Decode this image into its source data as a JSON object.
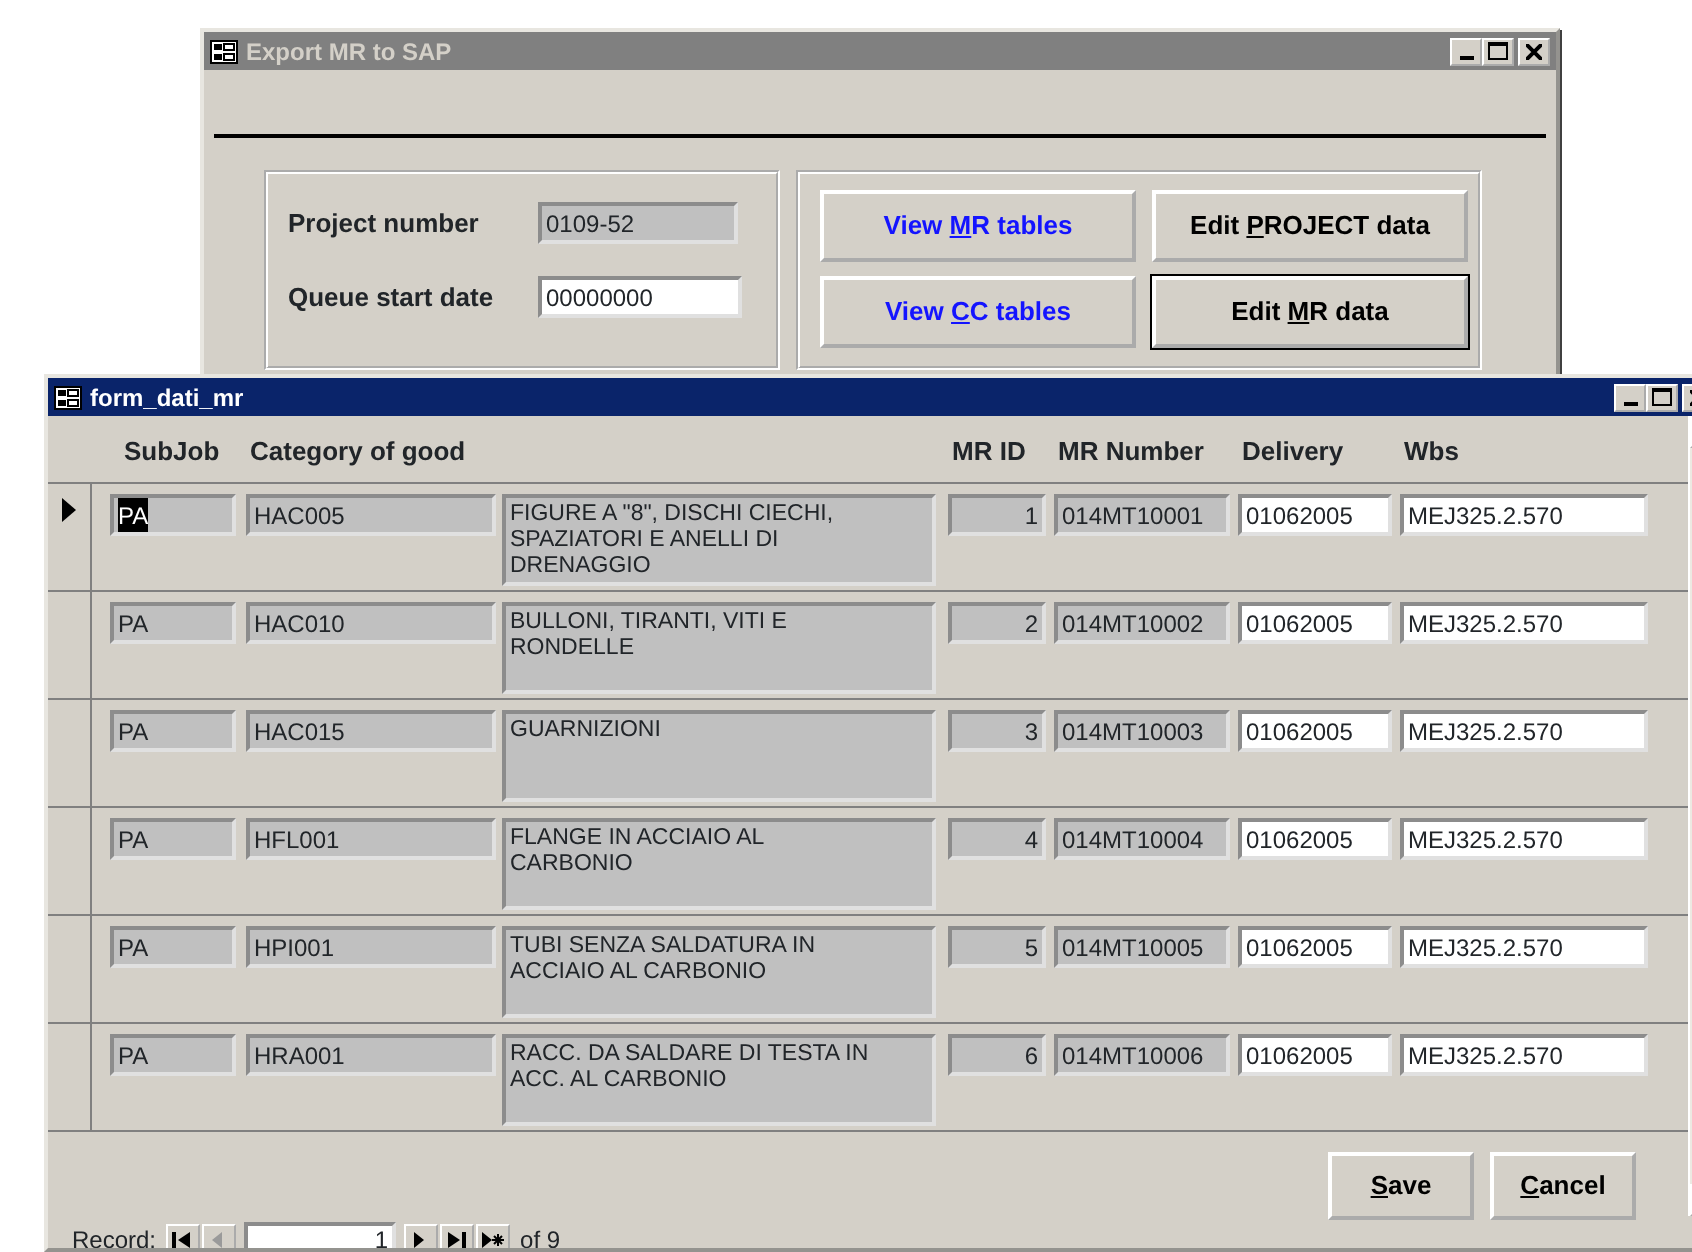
{
  "main_window": {
    "title": "Export MR to SAP",
    "active": false,
    "fields": [
      {
        "label": "Project number",
        "value": "0109-52",
        "locked": true
      },
      {
        "label": "Queue start date",
        "value": "00000000",
        "locked": false
      }
    ],
    "buttons": [
      {
        "label_parts": [
          "View ",
          "M",
          "R tables"
        ],
        "kind": "hyperlink",
        "default": false
      },
      {
        "label_parts": [
          "Edit ",
          "P",
          "ROJECT data"
        ],
        "kind": "command",
        "default": false
      },
      {
        "label_parts": [
          "View ",
          "C",
          "C tables"
        ],
        "kind": "hyperlink",
        "default": false
      },
      {
        "label_parts": [
          "Edit ",
          "M",
          "R data"
        ],
        "kind": "command",
        "default": true
      }
    ]
  },
  "form_window": {
    "title": "form_dati_mr",
    "active": true,
    "columns": [
      {
        "label": "SubJob",
        "locked": true
      },
      {
        "label": "Category of good",
        "locked": true
      },
      {
        "locked": true
      },
      {
        "label": "MR ID",
        "locked": true
      },
      {
        "label": "MR Number",
        "locked": true
      },
      {
        "label": "Delivery",
        "locked": false
      },
      {
        "label": "Wbs",
        "locked": false
      }
    ],
    "rows": [
      {
        "current": true,
        "cells": [
          "PA",
          "HAC005",
          "FIGURE A \"8\", DISCHI CIECHI, SPAZIATORI E ANELLI DI DRENAGGIO",
          "1",
          "014MT10001",
          "01062005",
          "MEJ325.2.570"
        ]
      },
      {
        "current": false,
        "cells": [
          "PA",
          "HAC010",
          "BULLONI, TIRANTI, VITI E RONDELLE",
          "2",
          "014MT10002",
          "01062005",
          "MEJ325.2.570"
        ]
      },
      {
        "current": false,
        "cells": [
          "PA",
          "HAC015",
          "GUARNIZIONI",
          "3",
          "014MT10003",
          "01062005",
          "MEJ325.2.570"
        ]
      },
      {
        "current": false,
        "cells": [
          "PA",
          "HFL001",
          "FLANGE IN ACCIAIO AL CARBONIO",
          "4",
          "014MT10004",
          "01062005",
          "MEJ325.2.570"
        ]
      },
      {
        "current": false,
        "cells": [
          "PA",
          "HPI001",
          "TUBI SENZA SALDATURA IN ACCIAIO AL CARBONIO",
          "5",
          "014MT10005",
          "01062005",
          "MEJ325.2.570"
        ]
      },
      {
        "current": false,
        "cells": [
          "PA",
          "HRA001",
          "RACC. DA SALDARE DI TESTA IN ACC. AL CARBONIO",
          "6",
          "014MT10006",
          "01062005",
          "MEJ325.2.570"
        ]
      }
    ],
    "buttons": [
      {
        "label_parts": [
          "S",
          "ave"
        ]
      },
      {
        "label_parts": [
          "C",
          "ancel"
        ]
      }
    ],
    "navigation": {
      "label": "Record:",
      "current": "1",
      "total": "of 9",
      "buttons": [
        {
          "kind": "first",
          "disabled": false
        },
        {
          "kind": "prev",
          "disabled": true
        },
        {
          "kind": "next",
          "disabled": false
        },
        {
          "kind": "last",
          "disabled": false
        },
        {
          "kind": "new",
          "disabled": false
        }
      ]
    }
  }
}
